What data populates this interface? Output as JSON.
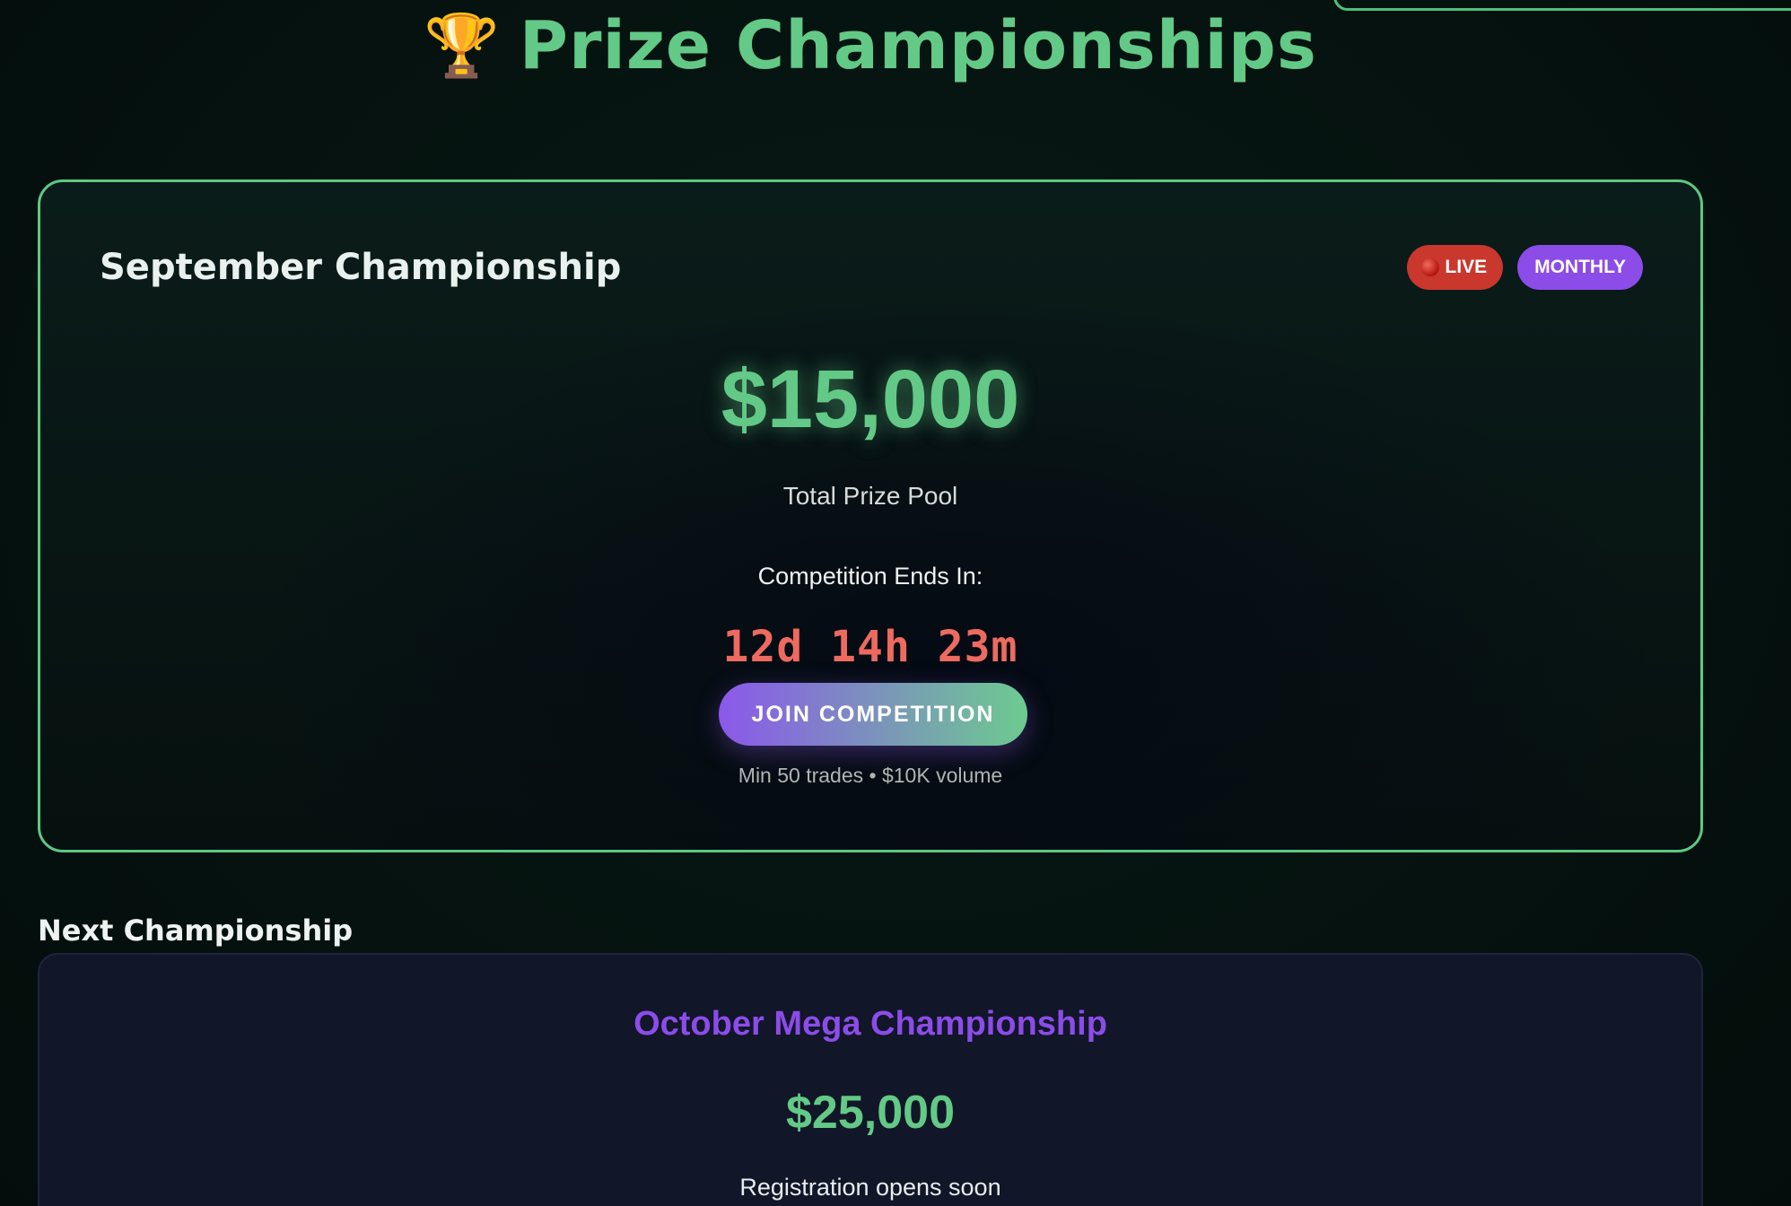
{
  "header": {
    "icon": "trophy-icon",
    "title": "Prize Championships"
  },
  "current_championship": {
    "title": "September Championship",
    "badges": {
      "live": "LIVE",
      "monthly": "MONTHLY"
    },
    "prize_amount": "$15,000",
    "prize_label": "Total Prize Pool",
    "ends_label": "Competition Ends In:",
    "countdown": "12d 14h 23m",
    "join_button": "JOIN COMPETITION",
    "requirements": "Min 50 trades • $10K volume"
  },
  "next_section": {
    "heading": "Next Championship",
    "title": "October Mega Championship",
    "prize_amount": "$25,000",
    "status": "Registration opens soon"
  },
  "colors": {
    "accent_green": "#63c986",
    "accent_purple": "#8b4ce8",
    "live_red": "#c9372d",
    "countdown_red": "#ee6a5f",
    "background": "#05120f"
  }
}
